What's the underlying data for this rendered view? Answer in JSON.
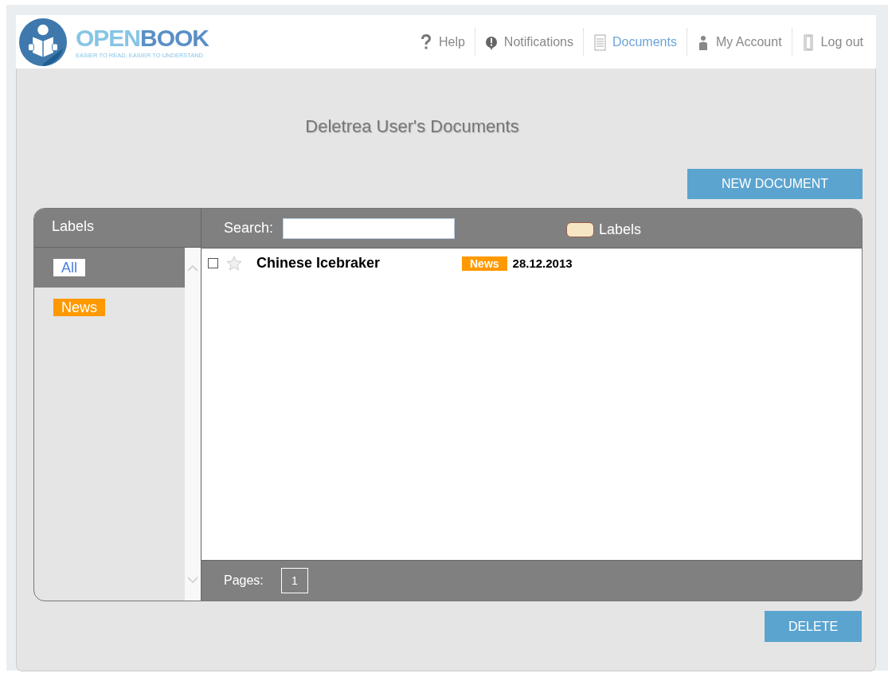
{
  "logo": {
    "name_light": "OPEN",
    "name_dark": "BOOK",
    "tagline": "EASIER TO READ, EASIER TO UNDERSTAND"
  },
  "nav": [
    {
      "kind": "help",
      "label": "Help",
      "selected": false
    },
    {
      "kind": "notifications",
      "label": "Notifications",
      "selected": false
    },
    {
      "kind": "documents",
      "label": "Documents",
      "selected": true
    },
    {
      "kind": "account",
      "label": "My Account",
      "selected": false
    },
    {
      "kind": "logout",
      "label": "Log out",
      "selected": false
    }
  ],
  "page_title": "Deletrea User's Documents",
  "new_button": "NEW DOCUMENT",
  "labels_panel": {
    "heading": "Labels",
    "items": [
      {
        "label": "All",
        "selected": true,
        "color": "#ffffff"
      },
      {
        "label": "News",
        "selected": false,
        "color": "#ff9900"
      }
    ]
  },
  "search": {
    "label": "Search:"
  },
  "labels_button": "Labels",
  "documents": [
    {
      "title": "Chinese Icebraker",
      "checked": false,
      "starred": false,
      "tag": "News",
      "color": "#ff9900",
      "date": "28.12.2013"
    }
  ],
  "pages": {
    "label": "Pages:",
    "items": [
      {
        "label": "1",
        "selected": true
      }
    ]
  },
  "delete_button": "DELETE"
}
